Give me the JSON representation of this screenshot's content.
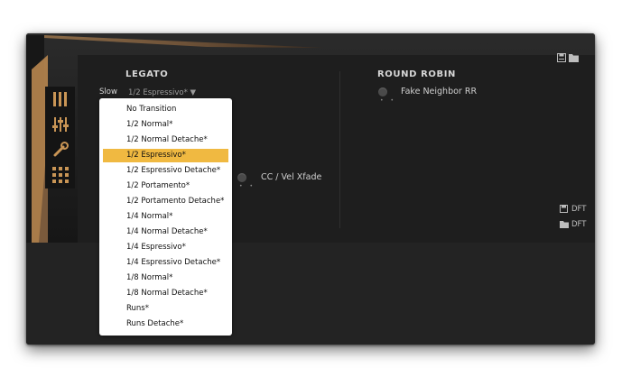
{
  "legato": {
    "title": "LEGATO",
    "slow_label": "Slow",
    "selected_value": "1/2 Espressivo* ▼",
    "cc_label": "CC / Vel Xfade"
  },
  "round_robin": {
    "title": "ROUND ROBIN",
    "fake_neighbor_label": "Fake Neighbor RR"
  },
  "presets": {
    "save_label": "DFT",
    "load_label": "DFT"
  },
  "icons": {
    "sidebar": [
      "bars-icon",
      "sliders-icon",
      "wrench-icon",
      "grid-icon"
    ],
    "top_right": [
      "save-icon",
      "folder-icon"
    ]
  },
  "colors": {
    "accent": "#b8864f",
    "selected": "#f0b941",
    "background": "#1c1c1c"
  },
  "dropdown": {
    "selected_index": 3,
    "items": [
      "No Transition",
      "1/2 Normal*",
      "1/2 Normal Detache*",
      "1/2 Espressivo*",
      "1/2 Espressivo Detache*",
      "1/2 Portamento*",
      "1/2 Portamento Detache*",
      "1/4 Normal*",
      "1/4 Normal Detache*",
      "1/4 Espressivo*",
      "1/4 Espressivo Detache*",
      "1/8 Normal*",
      "1/8 Normal Detache*",
      "Runs*",
      "Runs Detache*"
    ]
  }
}
